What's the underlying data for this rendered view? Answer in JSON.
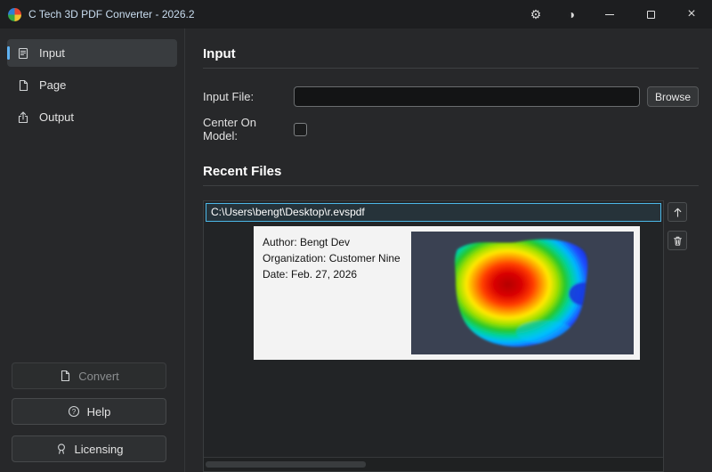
{
  "window": {
    "title": "C Tech 3D PDF Converter - 2026.2"
  },
  "titlebar": {
    "settings_glyph": "⚙",
    "theme_glyph": "◑",
    "close_glyph": "×",
    "icons": [
      "app-logo-icon",
      "gear-icon",
      "contrast-icon",
      "minimize-icon",
      "maximize-icon",
      "close-icon"
    ]
  },
  "sidebar": {
    "items": [
      {
        "label": "Input",
        "icon": "form-icon",
        "selected": true
      },
      {
        "label": "Page",
        "icon": "page-icon",
        "selected": false
      },
      {
        "label": "Output",
        "icon": "export-icon",
        "selected": false
      }
    ],
    "actions": {
      "convert": "Convert",
      "help": "Help",
      "licensing": "Licensing"
    }
  },
  "main": {
    "input": {
      "heading": "Input",
      "file_label": "Input File:",
      "file_value": "",
      "browse_label": "Browse",
      "center_label": "Center On Model:",
      "center_checked": false
    },
    "recent": {
      "heading": "Recent Files",
      "files": [
        {
          "path": "C:\\Users\\bengt\\Desktop\\r.evspdf",
          "selected": true
        }
      ],
      "preview": {
        "author": "Author: Bengt Dev",
        "organization": "Organization: Customer Nine",
        "date": "Date: Feb. 27, 2026"
      }
    }
  },
  "colors": {
    "accent": "#5fb2f2",
    "selection_border": "#4cb8e8",
    "preview_card_bg": "#f3f3f3",
    "preview_image_bg": "#3a4152",
    "titlebar_bg": "#1d1e20",
    "window_bg": "#27282a"
  }
}
